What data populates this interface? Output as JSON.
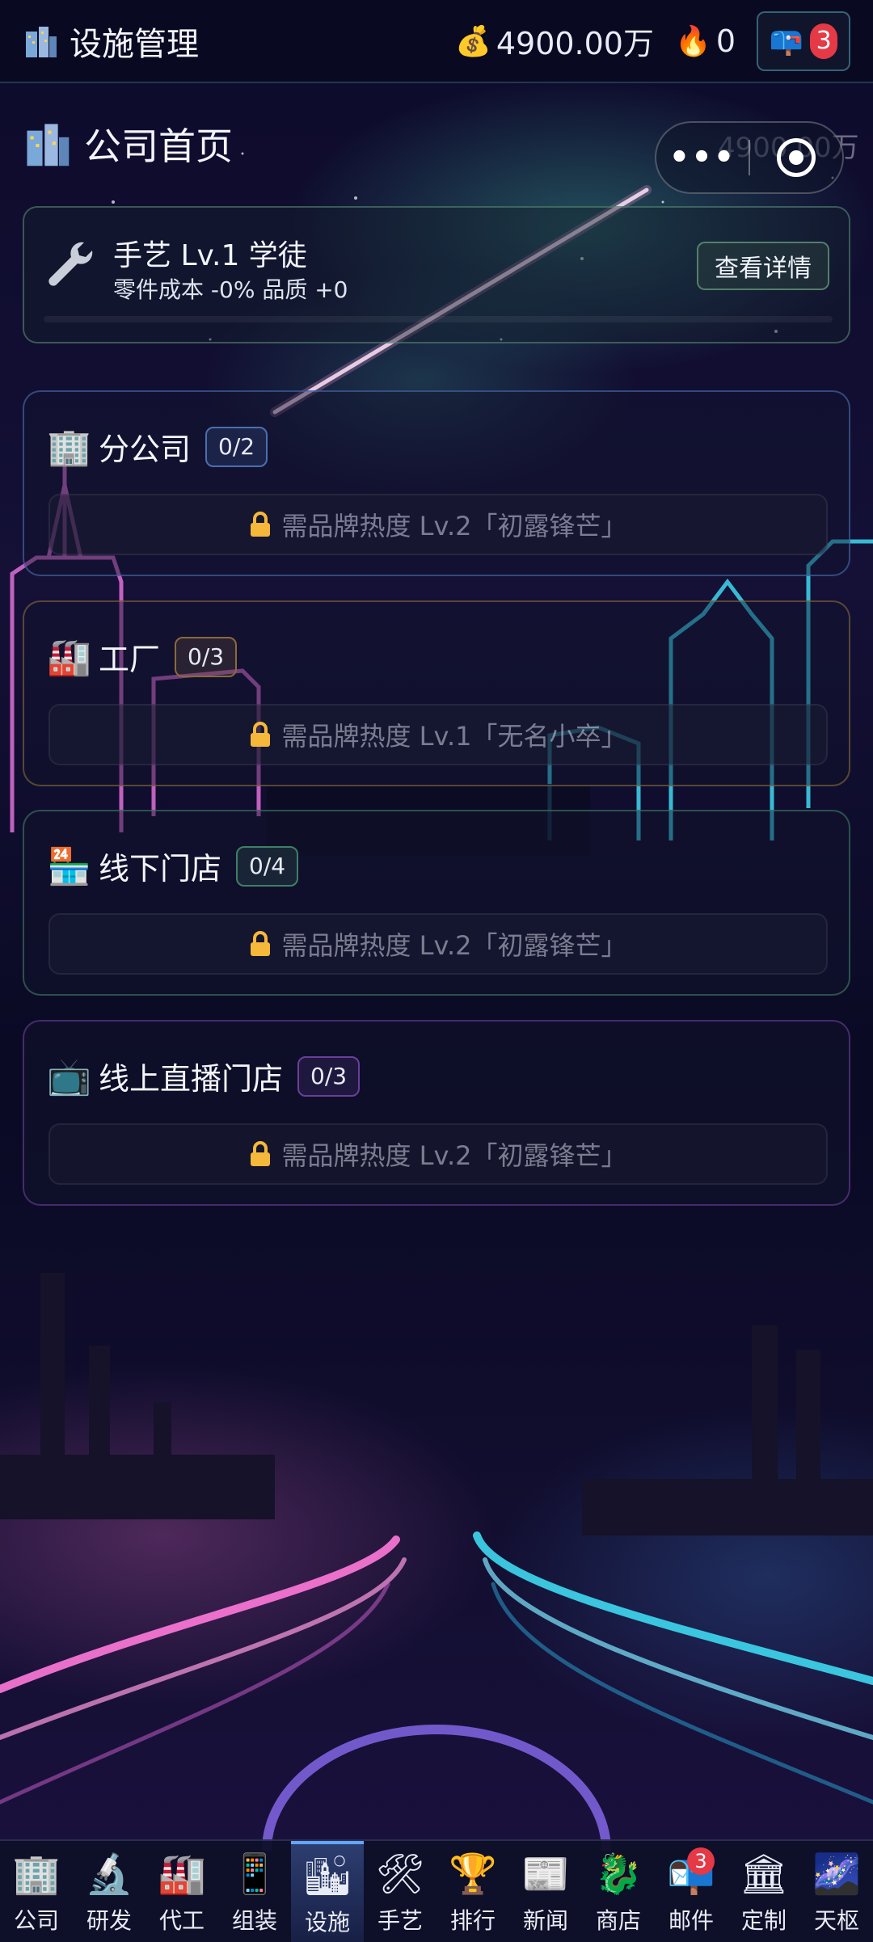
{
  "topbar": {
    "title": "设施管理",
    "money": "4900.00万",
    "money_icon": "money-bag-icon",
    "heat": "0",
    "heat_icon": "fire-icon",
    "mail_count": "3"
  },
  "home": {
    "title": "公司首页",
    "ghost_money": "4900.00万"
  },
  "craft": {
    "name": "手艺 Lv.1  学徒",
    "stats": "零件成本 -0%  品质 +0",
    "detail_button": "查看详情",
    "progress": 0
  },
  "facilities": [
    {
      "icon": "🏢",
      "name": "分公司",
      "count": "0/2",
      "lock_text": "需品牌热度 Lv.2「初露锋芒」",
      "accent": "#4a6fb0"
    },
    {
      "icon": "🏭",
      "name": "工厂",
      "count": "0/3",
      "lock_text": "需品牌热度 Lv.1「无名小卒」",
      "accent": "#8a6a3a"
    },
    {
      "icon": "🏪",
      "name": "线下门店",
      "count": "0/4",
      "lock_text": "需品牌热度 Lv.2「初露锋芒」",
      "accent": "#3f7f66"
    },
    {
      "icon": "📺",
      "name": "线上直播门店",
      "count": "0/3",
      "lock_text": "需品牌热度 Lv.2「初露锋芒」",
      "accent": "#6a3f9a"
    }
  ],
  "nav": [
    {
      "icon": "🏢",
      "label": "公司"
    },
    {
      "icon": "🔬",
      "label": "研发"
    },
    {
      "icon": "🏭",
      "label": "代工"
    },
    {
      "icon": "📱",
      "label": "组装"
    },
    {
      "icon": "🏙",
      "label": "设施",
      "active": true
    },
    {
      "icon": "🛠",
      "label": "手艺"
    },
    {
      "icon": "🏆",
      "label": "排行"
    },
    {
      "icon": "📰",
      "label": "新闻"
    },
    {
      "icon": "🐉",
      "label": "商店"
    },
    {
      "icon": "📬",
      "label": "邮件",
      "badge": "3"
    },
    {
      "icon": "🏛",
      "label": "定制"
    },
    {
      "icon": "🌌",
      "label": "天枢"
    }
  ]
}
